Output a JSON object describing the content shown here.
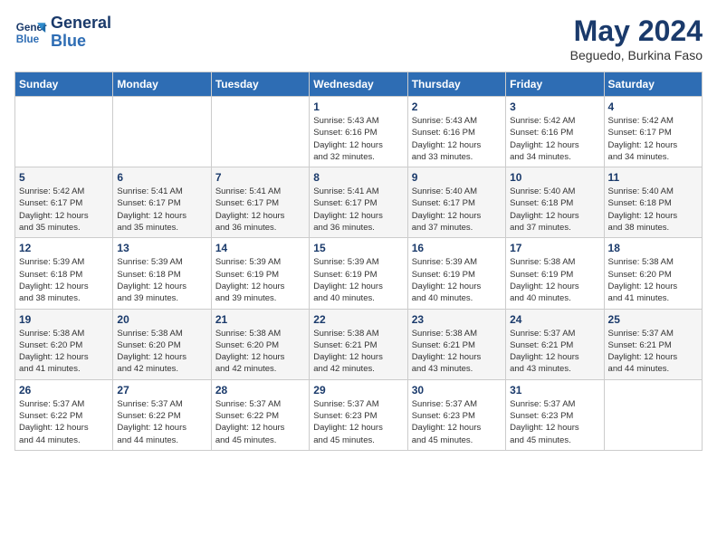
{
  "header": {
    "logo_line1": "General",
    "logo_line2": "Blue",
    "month": "May 2024",
    "location": "Beguedo, Burkina Faso"
  },
  "days_of_week": [
    "Sunday",
    "Monday",
    "Tuesday",
    "Wednesday",
    "Thursday",
    "Friday",
    "Saturday"
  ],
  "weeks": [
    [
      {
        "day": "",
        "info": ""
      },
      {
        "day": "",
        "info": ""
      },
      {
        "day": "",
        "info": ""
      },
      {
        "day": "1",
        "info": "Sunrise: 5:43 AM\nSunset: 6:16 PM\nDaylight: 12 hours\nand 32 minutes."
      },
      {
        "day": "2",
        "info": "Sunrise: 5:43 AM\nSunset: 6:16 PM\nDaylight: 12 hours\nand 33 minutes."
      },
      {
        "day": "3",
        "info": "Sunrise: 5:42 AM\nSunset: 6:16 PM\nDaylight: 12 hours\nand 34 minutes."
      },
      {
        "day": "4",
        "info": "Sunrise: 5:42 AM\nSunset: 6:17 PM\nDaylight: 12 hours\nand 34 minutes."
      }
    ],
    [
      {
        "day": "5",
        "info": "Sunrise: 5:42 AM\nSunset: 6:17 PM\nDaylight: 12 hours\nand 35 minutes."
      },
      {
        "day": "6",
        "info": "Sunrise: 5:41 AM\nSunset: 6:17 PM\nDaylight: 12 hours\nand 35 minutes."
      },
      {
        "day": "7",
        "info": "Sunrise: 5:41 AM\nSunset: 6:17 PM\nDaylight: 12 hours\nand 36 minutes."
      },
      {
        "day": "8",
        "info": "Sunrise: 5:41 AM\nSunset: 6:17 PM\nDaylight: 12 hours\nand 36 minutes."
      },
      {
        "day": "9",
        "info": "Sunrise: 5:40 AM\nSunset: 6:17 PM\nDaylight: 12 hours\nand 37 minutes."
      },
      {
        "day": "10",
        "info": "Sunrise: 5:40 AM\nSunset: 6:18 PM\nDaylight: 12 hours\nand 37 minutes."
      },
      {
        "day": "11",
        "info": "Sunrise: 5:40 AM\nSunset: 6:18 PM\nDaylight: 12 hours\nand 38 minutes."
      }
    ],
    [
      {
        "day": "12",
        "info": "Sunrise: 5:39 AM\nSunset: 6:18 PM\nDaylight: 12 hours\nand 38 minutes."
      },
      {
        "day": "13",
        "info": "Sunrise: 5:39 AM\nSunset: 6:18 PM\nDaylight: 12 hours\nand 39 minutes."
      },
      {
        "day": "14",
        "info": "Sunrise: 5:39 AM\nSunset: 6:19 PM\nDaylight: 12 hours\nand 39 minutes."
      },
      {
        "day": "15",
        "info": "Sunrise: 5:39 AM\nSunset: 6:19 PM\nDaylight: 12 hours\nand 40 minutes."
      },
      {
        "day": "16",
        "info": "Sunrise: 5:39 AM\nSunset: 6:19 PM\nDaylight: 12 hours\nand 40 minutes."
      },
      {
        "day": "17",
        "info": "Sunrise: 5:38 AM\nSunset: 6:19 PM\nDaylight: 12 hours\nand 40 minutes."
      },
      {
        "day": "18",
        "info": "Sunrise: 5:38 AM\nSunset: 6:20 PM\nDaylight: 12 hours\nand 41 minutes."
      }
    ],
    [
      {
        "day": "19",
        "info": "Sunrise: 5:38 AM\nSunset: 6:20 PM\nDaylight: 12 hours\nand 41 minutes."
      },
      {
        "day": "20",
        "info": "Sunrise: 5:38 AM\nSunset: 6:20 PM\nDaylight: 12 hours\nand 42 minutes."
      },
      {
        "day": "21",
        "info": "Sunrise: 5:38 AM\nSunset: 6:20 PM\nDaylight: 12 hours\nand 42 minutes."
      },
      {
        "day": "22",
        "info": "Sunrise: 5:38 AM\nSunset: 6:21 PM\nDaylight: 12 hours\nand 42 minutes."
      },
      {
        "day": "23",
        "info": "Sunrise: 5:38 AM\nSunset: 6:21 PM\nDaylight: 12 hours\nand 43 minutes."
      },
      {
        "day": "24",
        "info": "Sunrise: 5:37 AM\nSunset: 6:21 PM\nDaylight: 12 hours\nand 43 minutes."
      },
      {
        "day": "25",
        "info": "Sunrise: 5:37 AM\nSunset: 6:21 PM\nDaylight: 12 hours\nand 44 minutes."
      }
    ],
    [
      {
        "day": "26",
        "info": "Sunrise: 5:37 AM\nSunset: 6:22 PM\nDaylight: 12 hours\nand 44 minutes."
      },
      {
        "day": "27",
        "info": "Sunrise: 5:37 AM\nSunset: 6:22 PM\nDaylight: 12 hours\nand 44 minutes."
      },
      {
        "day": "28",
        "info": "Sunrise: 5:37 AM\nSunset: 6:22 PM\nDaylight: 12 hours\nand 45 minutes."
      },
      {
        "day": "29",
        "info": "Sunrise: 5:37 AM\nSunset: 6:23 PM\nDaylight: 12 hours\nand 45 minutes."
      },
      {
        "day": "30",
        "info": "Sunrise: 5:37 AM\nSunset: 6:23 PM\nDaylight: 12 hours\nand 45 minutes."
      },
      {
        "day": "31",
        "info": "Sunrise: 5:37 AM\nSunset: 6:23 PM\nDaylight: 12 hours\nand 45 minutes."
      },
      {
        "day": "",
        "info": ""
      }
    ]
  ]
}
